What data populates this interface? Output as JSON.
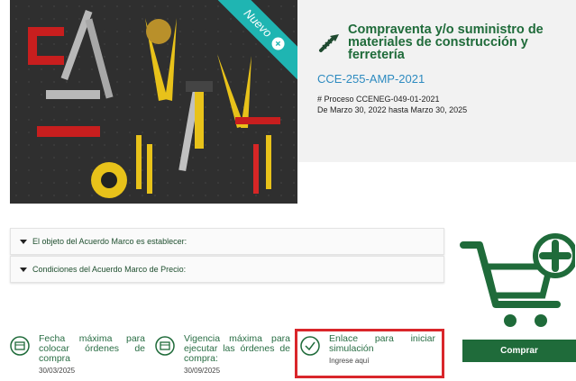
{
  "hero": {
    "badge": "Nuevo",
    "title": "Compraventa y/o suministro de materiales de construcción y ferretería",
    "code": "CCE-255-AMP-2021",
    "process": "# Proceso CCENEG-049-01-2021",
    "validity": "De Marzo 30, 2022 hasta Marzo 30, 2025"
  },
  "accordions": [
    {
      "label": "El objeto del Acuerdo Marco es establecer:"
    },
    {
      "label": "Condiciones del Acuerdo Marco de Precio:"
    }
  ],
  "info_blocks": [
    {
      "text": "Fecha máxima para colocar órdenes de compra",
      "value": "30/03/2025"
    },
    {
      "text": "Vigencia máxima para ejecutar las órdenes de compra:",
      "value": "30/09/2025"
    },
    {
      "text": "Enlace para iniciar simulación",
      "value": "Ingrese aquí"
    }
  ],
  "buy_button": "Comprar",
  "colors": {
    "brand_green": "#1f6b3a",
    "link_blue": "#2e8bc0",
    "ribbon_teal": "#1fb5b2",
    "highlight_red": "#d9262b"
  }
}
